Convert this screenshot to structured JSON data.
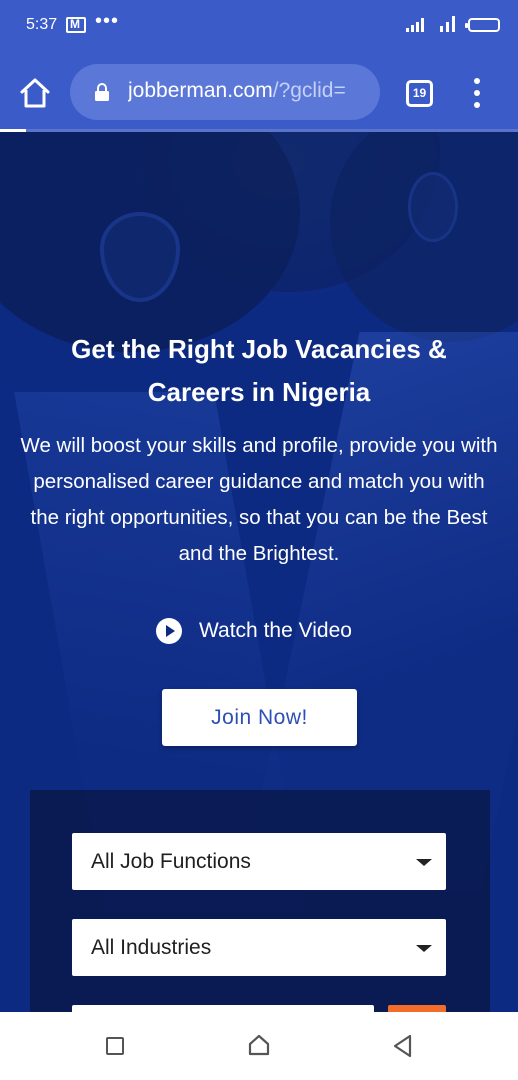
{
  "status_bar": {
    "time": "5:37",
    "dots": "•••",
    "icons": [
      "gmail-icon",
      "signal-icon",
      "battery-icon"
    ]
  },
  "browser": {
    "url_main": "jobberman.com",
    "url_rest": "/?gclid=",
    "tab_count": "19",
    "load_progress": 0.05
  },
  "hero": {
    "title_line1": "Get the Right Job Vacancies &",
    "title_line2": "Careers in Nigeria",
    "description": "We will boost your skills and profile, provide you with personalised career guidance and match you with the right opportunities, so that you can be the Best and the Brightest.",
    "watch_video_label": "Watch the Video",
    "join_label": "Join Now!"
  },
  "search": {
    "job_functions": "All Job Functions",
    "industries": "All Industries"
  },
  "colors": {
    "brand_blue": "#3b5cc8",
    "accent_orange": "#f26c2a"
  }
}
